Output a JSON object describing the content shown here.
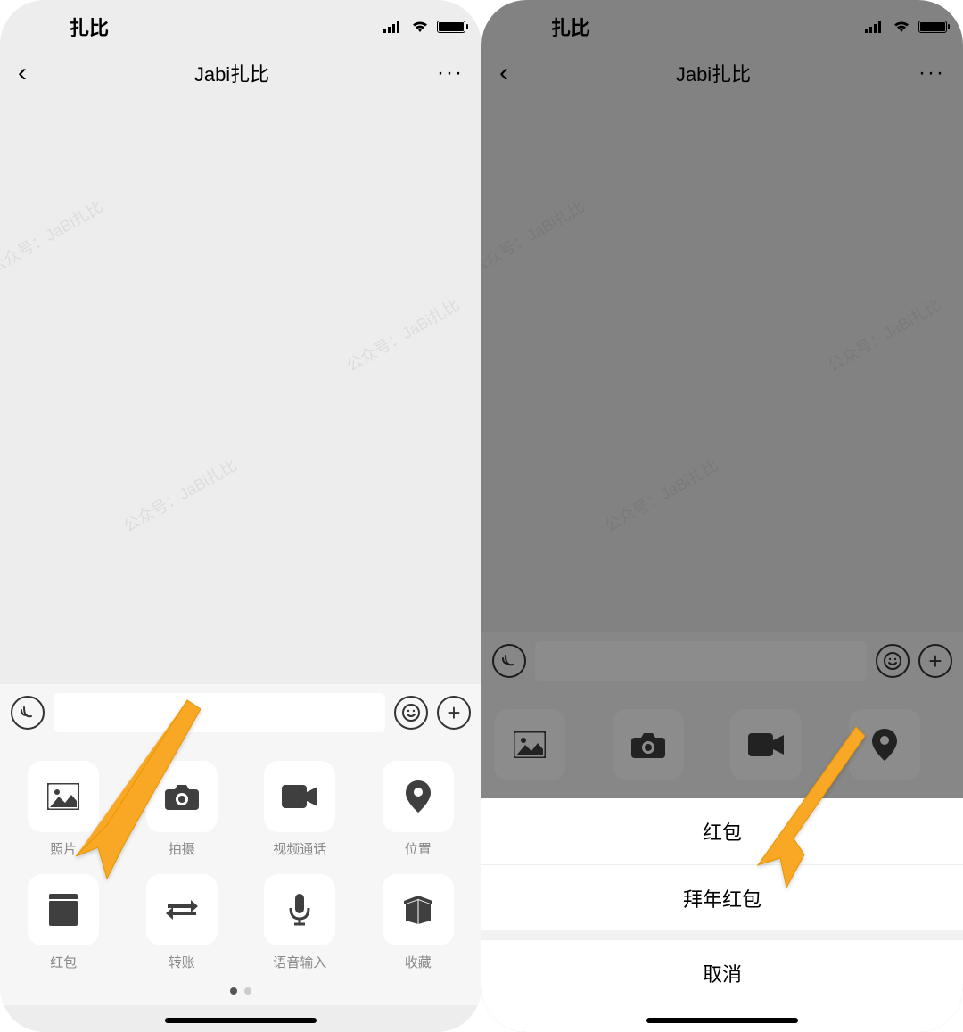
{
  "status": {
    "title": "扎比"
  },
  "nav": {
    "title": "Jabi扎比"
  },
  "watermark_lines": [
    "公众号：JaBi扎比",
    "公众号：JaBi扎比",
    "公众号：JaBi扎比",
    "公众号：JaBi扎比",
    "公众号：JaBi扎比"
  ],
  "attachments": [
    {
      "label": "照片",
      "icon": "photo-icon"
    },
    {
      "label": "拍摄",
      "icon": "camera-icon"
    },
    {
      "label": "视频通话",
      "icon": "video-icon"
    },
    {
      "label": "位置",
      "icon": "location-icon"
    },
    {
      "label": "红包",
      "icon": "redpacket-icon"
    },
    {
      "label": "转账",
      "icon": "transfer-icon"
    },
    {
      "label": "语音输入",
      "icon": "mic-icon"
    },
    {
      "label": "收藏",
      "icon": "favorite-icon"
    }
  ],
  "sheet": {
    "item1": "红包",
    "item2": "拜年红包",
    "cancel": "取消"
  }
}
